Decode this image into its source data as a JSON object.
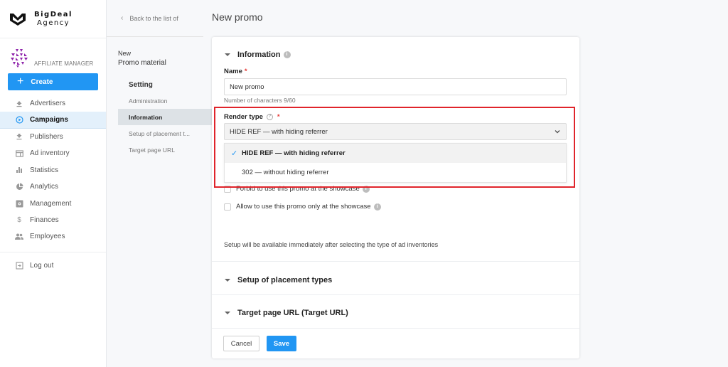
{
  "brand": {
    "name": "BigDeal",
    "sub": "Agency"
  },
  "profile": {
    "role": "AFFILIATE MANAGER"
  },
  "sidebar": {
    "create_label": "Create",
    "items": [
      {
        "label": "Advertisers",
        "icon": "upload-icon"
      },
      {
        "label": "Campaigns",
        "icon": "play-circle-icon",
        "active": true
      },
      {
        "label": "Publishers",
        "icon": "download-icon"
      },
      {
        "label": "Ad inventory",
        "icon": "ad-inventory-icon"
      },
      {
        "label": "Statistics",
        "icon": "bar-chart-icon"
      },
      {
        "label": "Analytics",
        "icon": "pie-chart-icon"
      },
      {
        "label": "Management",
        "icon": "settings-box-icon"
      },
      {
        "label": "Finances",
        "icon": "dollar-icon"
      },
      {
        "label": "Employees",
        "icon": "people-icon"
      }
    ],
    "logout_label": "Log out"
  },
  "subnav": {
    "back_label": "Back to the list of",
    "title_small": "New",
    "title_big": "Promo material",
    "group_label": "Setting",
    "items": [
      {
        "label": "Administration"
      },
      {
        "label": "Information",
        "active": true
      },
      {
        "label": "Setup of placement t..."
      },
      {
        "label": "Target page URL"
      }
    ]
  },
  "main": {
    "page_title": "New promo",
    "information": {
      "heading": "Information",
      "name_label": "Name",
      "name_value": "New promo",
      "char_count": "Number of characters 9/60",
      "render_type_label": "Render type",
      "render_type_value": "HIDE REF — with hiding referrer",
      "render_type_options": [
        {
          "label": "HIDE REF — with hiding referrer",
          "selected": true
        },
        {
          "label": "302 — without hiding referrer",
          "selected": false
        }
      ],
      "checkbox_forbid": "Forbid to use this promo at the showcase",
      "checkbox_allow": "Allow to use this promo only at the showcase",
      "setup_note": "Setup will be available immediately after selecting the type of ad inventories"
    },
    "placement_heading": "Setup of placement types",
    "target_heading": "Target page URL (Target URL)",
    "cancel_label": "Cancel",
    "save_label": "Save"
  },
  "colors": {
    "accent": "#2196f3",
    "highlight": "#e0242b",
    "required": "#e53935"
  }
}
